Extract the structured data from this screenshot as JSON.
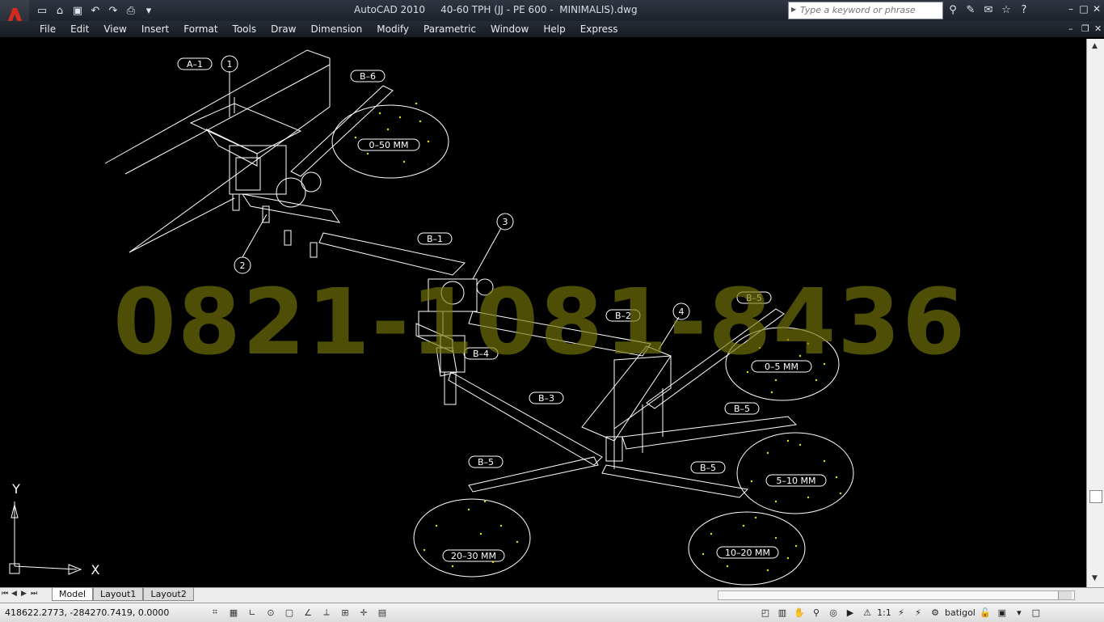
{
  "window": {
    "title": "AutoCAD 2010     40-60 TPH (JJ - PE 600 -  MINIMALIS).dwg",
    "search_placeholder": "Type a keyword or phrase"
  },
  "menu": [
    "File",
    "Edit",
    "View",
    "Insert",
    "Format",
    "Tools",
    "Draw",
    "Dimension",
    "Modify",
    "Parametric",
    "Window",
    "Help",
    "Express"
  ],
  "drawing": {
    "labels": {
      "a1": "A–1",
      "b6": "B–6",
      "b1": "B–1",
      "b2": "B–2",
      "b3": "B–3",
      "b4": "B–4",
      "b5a": "B–5",
      "b5b": "B–5",
      "b5c": "B–5",
      "b5d": "B–5"
    },
    "callouts": {
      "c1": "1",
      "c2": "2",
      "c3": "3",
      "c4": "4"
    },
    "piles": {
      "p1": "0–50  MM",
      "p2": "0–5  MM",
      "p3": "5–10  MM",
      "p4": "10–20  MM",
      "p5": "20–30  MM"
    },
    "ucs": {
      "x": "X",
      "y": "Y"
    },
    "watermark": "0821-1081-8436"
  },
  "tabs": {
    "model": "Model",
    "layout1": "Layout1",
    "layout2": "Layout2"
  },
  "status": {
    "coords": "418622.2773, -284270.7419, 0.0000",
    "scale": "1:1",
    "workspace": "batigol"
  },
  "colors": {
    "background": "#000000",
    "lines": "#ffffff",
    "aggregate": "#e8e000"
  }
}
